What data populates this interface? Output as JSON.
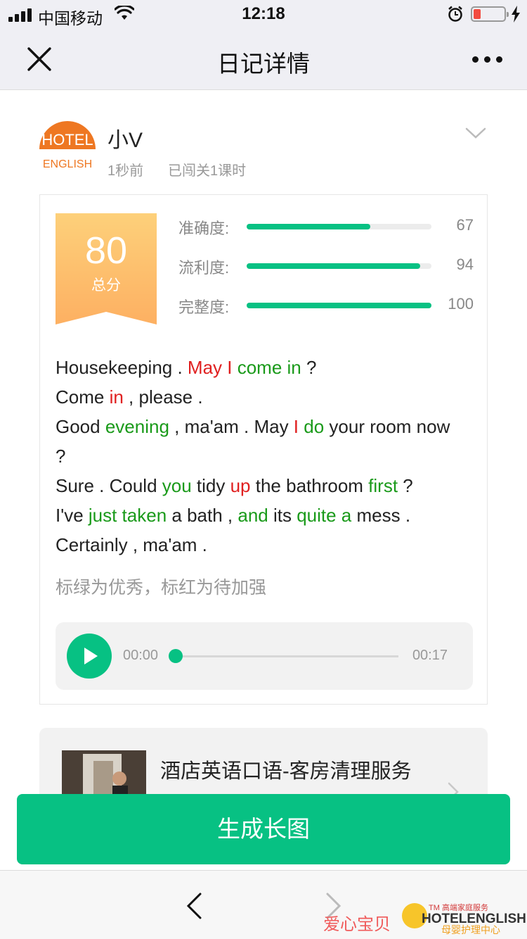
{
  "status_bar": {
    "carrier": "中国移动",
    "time": "12:18",
    "battery_level": 0.2
  },
  "nav": {
    "title": "日记详情",
    "close_icon": "close-icon",
    "more_icon": "more-icon"
  },
  "user": {
    "avatar_top": "HOTEL",
    "avatar_bottom": "ENGLISH",
    "name": "小V",
    "time_ago": "1秒前",
    "progress": "已闯关1课时"
  },
  "score": {
    "total": "80",
    "total_label": "总分",
    "metrics": [
      {
        "label": "准确度:",
        "value": "67",
        "fraction": 0.67
      },
      {
        "label": "流利度:",
        "value": "94",
        "fraction": 0.94
      },
      {
        "label": "完整度:",
        "value": "100",
        "fraction": 1.0
      }
    ]
  },
  "dialogue": [
    {
      "segments": [
        {
          "t": "Housekeeping . ",
          "c": ""
        },
        {
          "t": "May I",
          "c": "r"
        },
        {
          "t": " ",
          "c": ""
        },
        {
          "t": "come in",
          "c": "g"
        },
        {
          "t": " ?",
          "c": ""
        }
      ]
    },
    {
      "segments": [
        {
          "t": "Come ",
          "c": ""
        },
        {
          "t": "in",
          "c": "r"
        },
        {
          "t": " , please .",
          "c": ""
        }
      ]
    },
    {
      "segments": [
        {
          "t": "Good ",
          "c": ""
        },
        {
          "t": "evening",
          "c": "g"
        },
        {
          "t": " , ma'am . May ",
          "c": ""
        },
        {
          "t": "I",
          "c": "r"
        },
        {
          "t": " ",
          "c": ""
        },
        {
          "t": "do",
          "c": "g"
        },
        {
          "t": " your room now ?",
          "c": ""
        }
      ]
    },
    {
      "segments": [
        {
          "t": "Sure . Could ",
          "c": ""
        },
        {
          "t": "you",
          "c": "g"
        },
        {
          "t": " tidy ",
          "c": ""
        },
        {
          "t": "up",
          "c": "r"
        },
        {
          "t": " the bathroom ",
          "c": ""
        },
        {
          "t": "first",
          "c": "g"
        },
        {
          "t": " ?",
          "c": ""
        }
      ]
    },
    {
      "segments": [
        {
          "t": "I've ",
          "c": ""
        },
        {
          "t": "just taken",
          "c": "g"
        },
        {
          "t": " a bath , ",
          "c": ""
        },
        {
          "t": "and",
          "c": "g"
        },
        {
          "t": " its ",
          "c": ""
        },
        {
          "t": "quite a",
          "c": "g"
        },
        {
          "t": " mess .",
          "c": ""
        }
      ]
    },
    {
      "segments": [
        {
          "t": "Certainly , ma'am .",
          "c": ""
        }
      ]
    }
  ],
  "hint": "标绿为优秀，标红为待加强",
  "player": {
    "current": "00:00",
    "duration": "00:17",
    "progress": 0.0
  },
  "course": {
    "title": "酒店英语口语-客房清理服务"
  },
  "generate_button": "生成长图",
  "watermark": {
    "left": "爱心宝贝",
    "tm": "TM 高端家庭服务",
    "brand": "HOTELENGLISH",
    "sub": "母婴护理中心"
  },
  "colors": {
    "accent": "#07c183",
    "good": "#1a9a1a",
    "weak": "#e02020",
    "badge_top": "#fdd07a",
    "badge_bottom": "#fdb062"
  }
}
